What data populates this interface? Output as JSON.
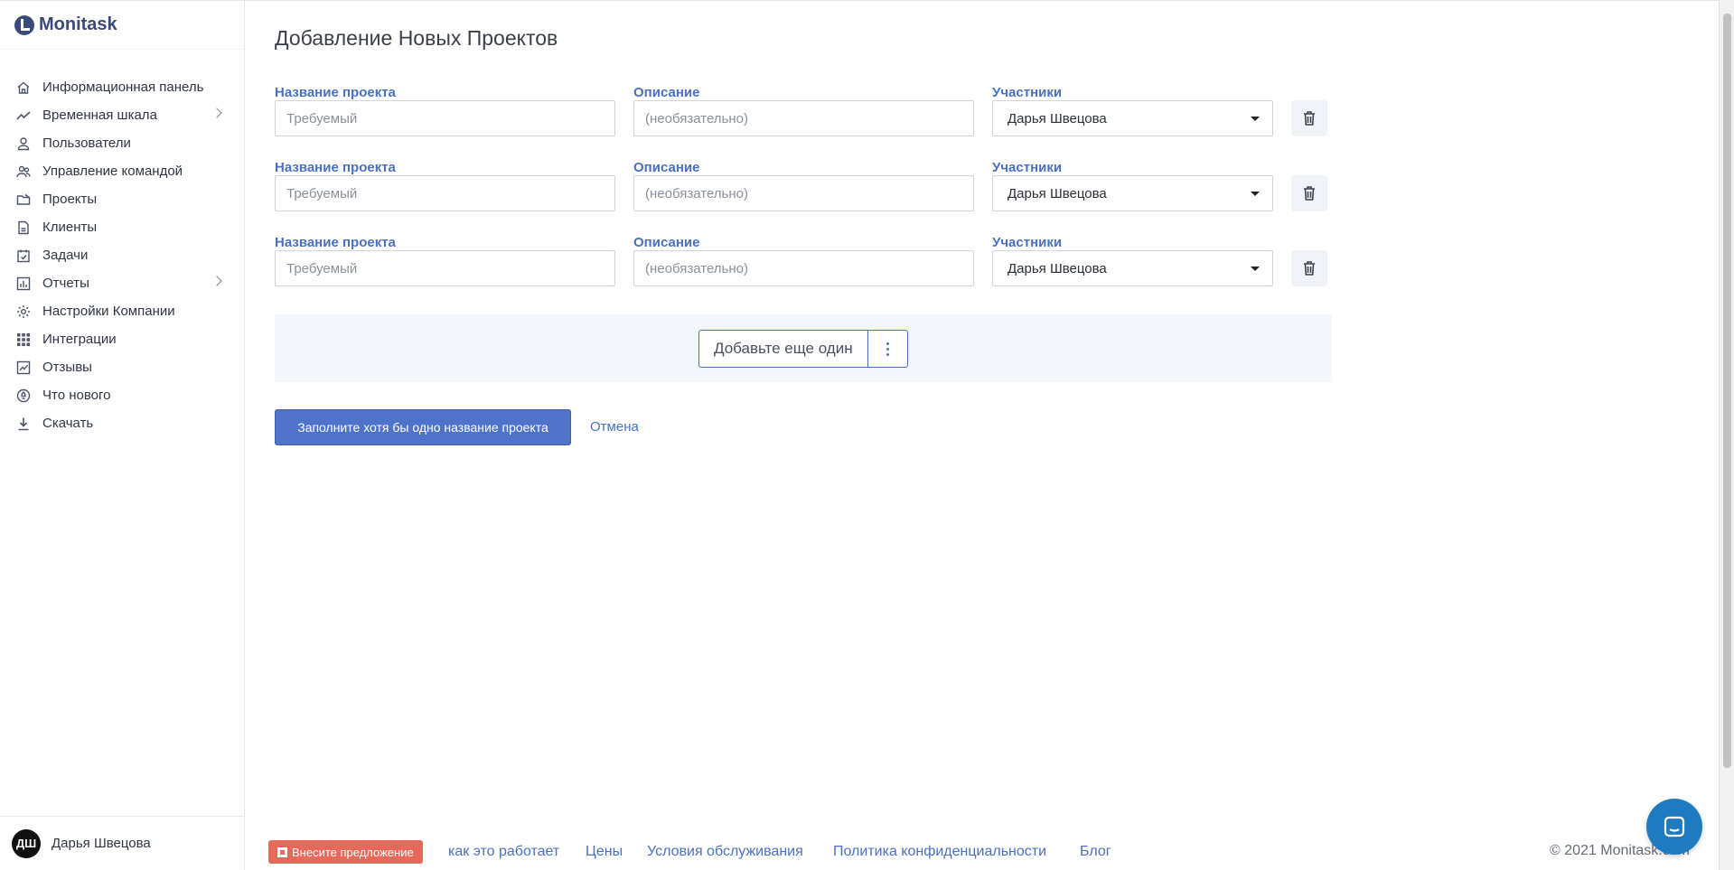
{
  "app": {
    "name": "Monitask"
  },
  "sidebar": {
    "items": [
      {
        "label": "Информационная панель",
        "icon": "home-icon",
        "chevron": false
      },
      {
        "label": "Временная шкала",
        "icon": "trend-line-icon",
        "chevron": true
      },
      {
        "label": "Пользователи",
        "icon": "user-icon",
        "chevron": false
      },
      {
        "label": "Управление командой",
        "icon": "team-icon",
        "chevron": false
      },
      {
        "label": "Проекты",
        "icon": "folder-icon",
        "chevron": false
      },
      {
        "label": "Клиенты",
        "icon": "document-icon",
        "chevron": false
      },
      {
        "label": "Задачи",
        "icon": "calendar-check-icon",
        "chevron": false
      },
      {
        "label": "Отчеты",
        "icon": "bar-chart-icon",
        "chevron": true
      },
      {
        "label": "Настройки Компании",
        "icon": "gear-icon",
        "chevron": false
      },
      {
        "label": "Интеграции",
        "icon": "grid-icon",
        "chevron": false
      },
      {
        "label": "Отзывы",
        "icon": "feedback-chart-icon",
        "chevron": false
      },
      {
        "label": "Что нового",
        "icon": "rocket-icon",
        "chevron": false
      },
      {
        "label": "Скачать",
        "icon": "download-icon",
        "chevron": false
      }
    ],
    "user": {
      "initials": "ДШ",
      "name": "Дарья Швецова"
    }
  },
  "main": {
    "title": "Добавление Новых Проектов",
    "rows": [
      {
        "name_label": "Название проекта",
        "name_placeholder": "Требуемый",
        "desc_label": "Описание",
        "desc_placeholder": "(необязательно)",
        "members_label": "Участники",
        "members_value": "Дарья Швецова"
      },
      {
        "name_label": "Название проекта",
        "name_placeholder": "Требуемый",
        "desc_label": "Описание",
        "desc_placeholder": "(необязательно)",
        "members_label": "Участники",
        "members_value": "Дарья Швецова"
      },
      {
        "name_label": "Название проекта",
        "name_placeholder": "Требуемый",
        "desc_label": "Описание",
        "desc_placeholder": "(необязательно)",
        "members_label": "Участники",
        "members_value": "Дарья Швецова"
      }
    ],
    "add_another_label": "Добавьте еще один",
    "submit_label": "Заполните хотя бы одно название проекта",
    "cancel_label": "Отмена"
  },
  "footer": {
    "suggest_label": "Внесите предложение",
    "links": [
      "как это работает",
      "Цены",
      "Условия обслуживания",
      "Политика конфиденциальности",
      "Блог"
    ],
    "copyright": "© 2021 Monitask.com"
  },
  "colors": {
    "accent": "#4a70c2",
    "primary_button": "#4e73c8",
    "suggest_button": "#e8695c",
    "chat_button": "#1f7bc0",
    "brand": "#3a4a7a"
  }
}
